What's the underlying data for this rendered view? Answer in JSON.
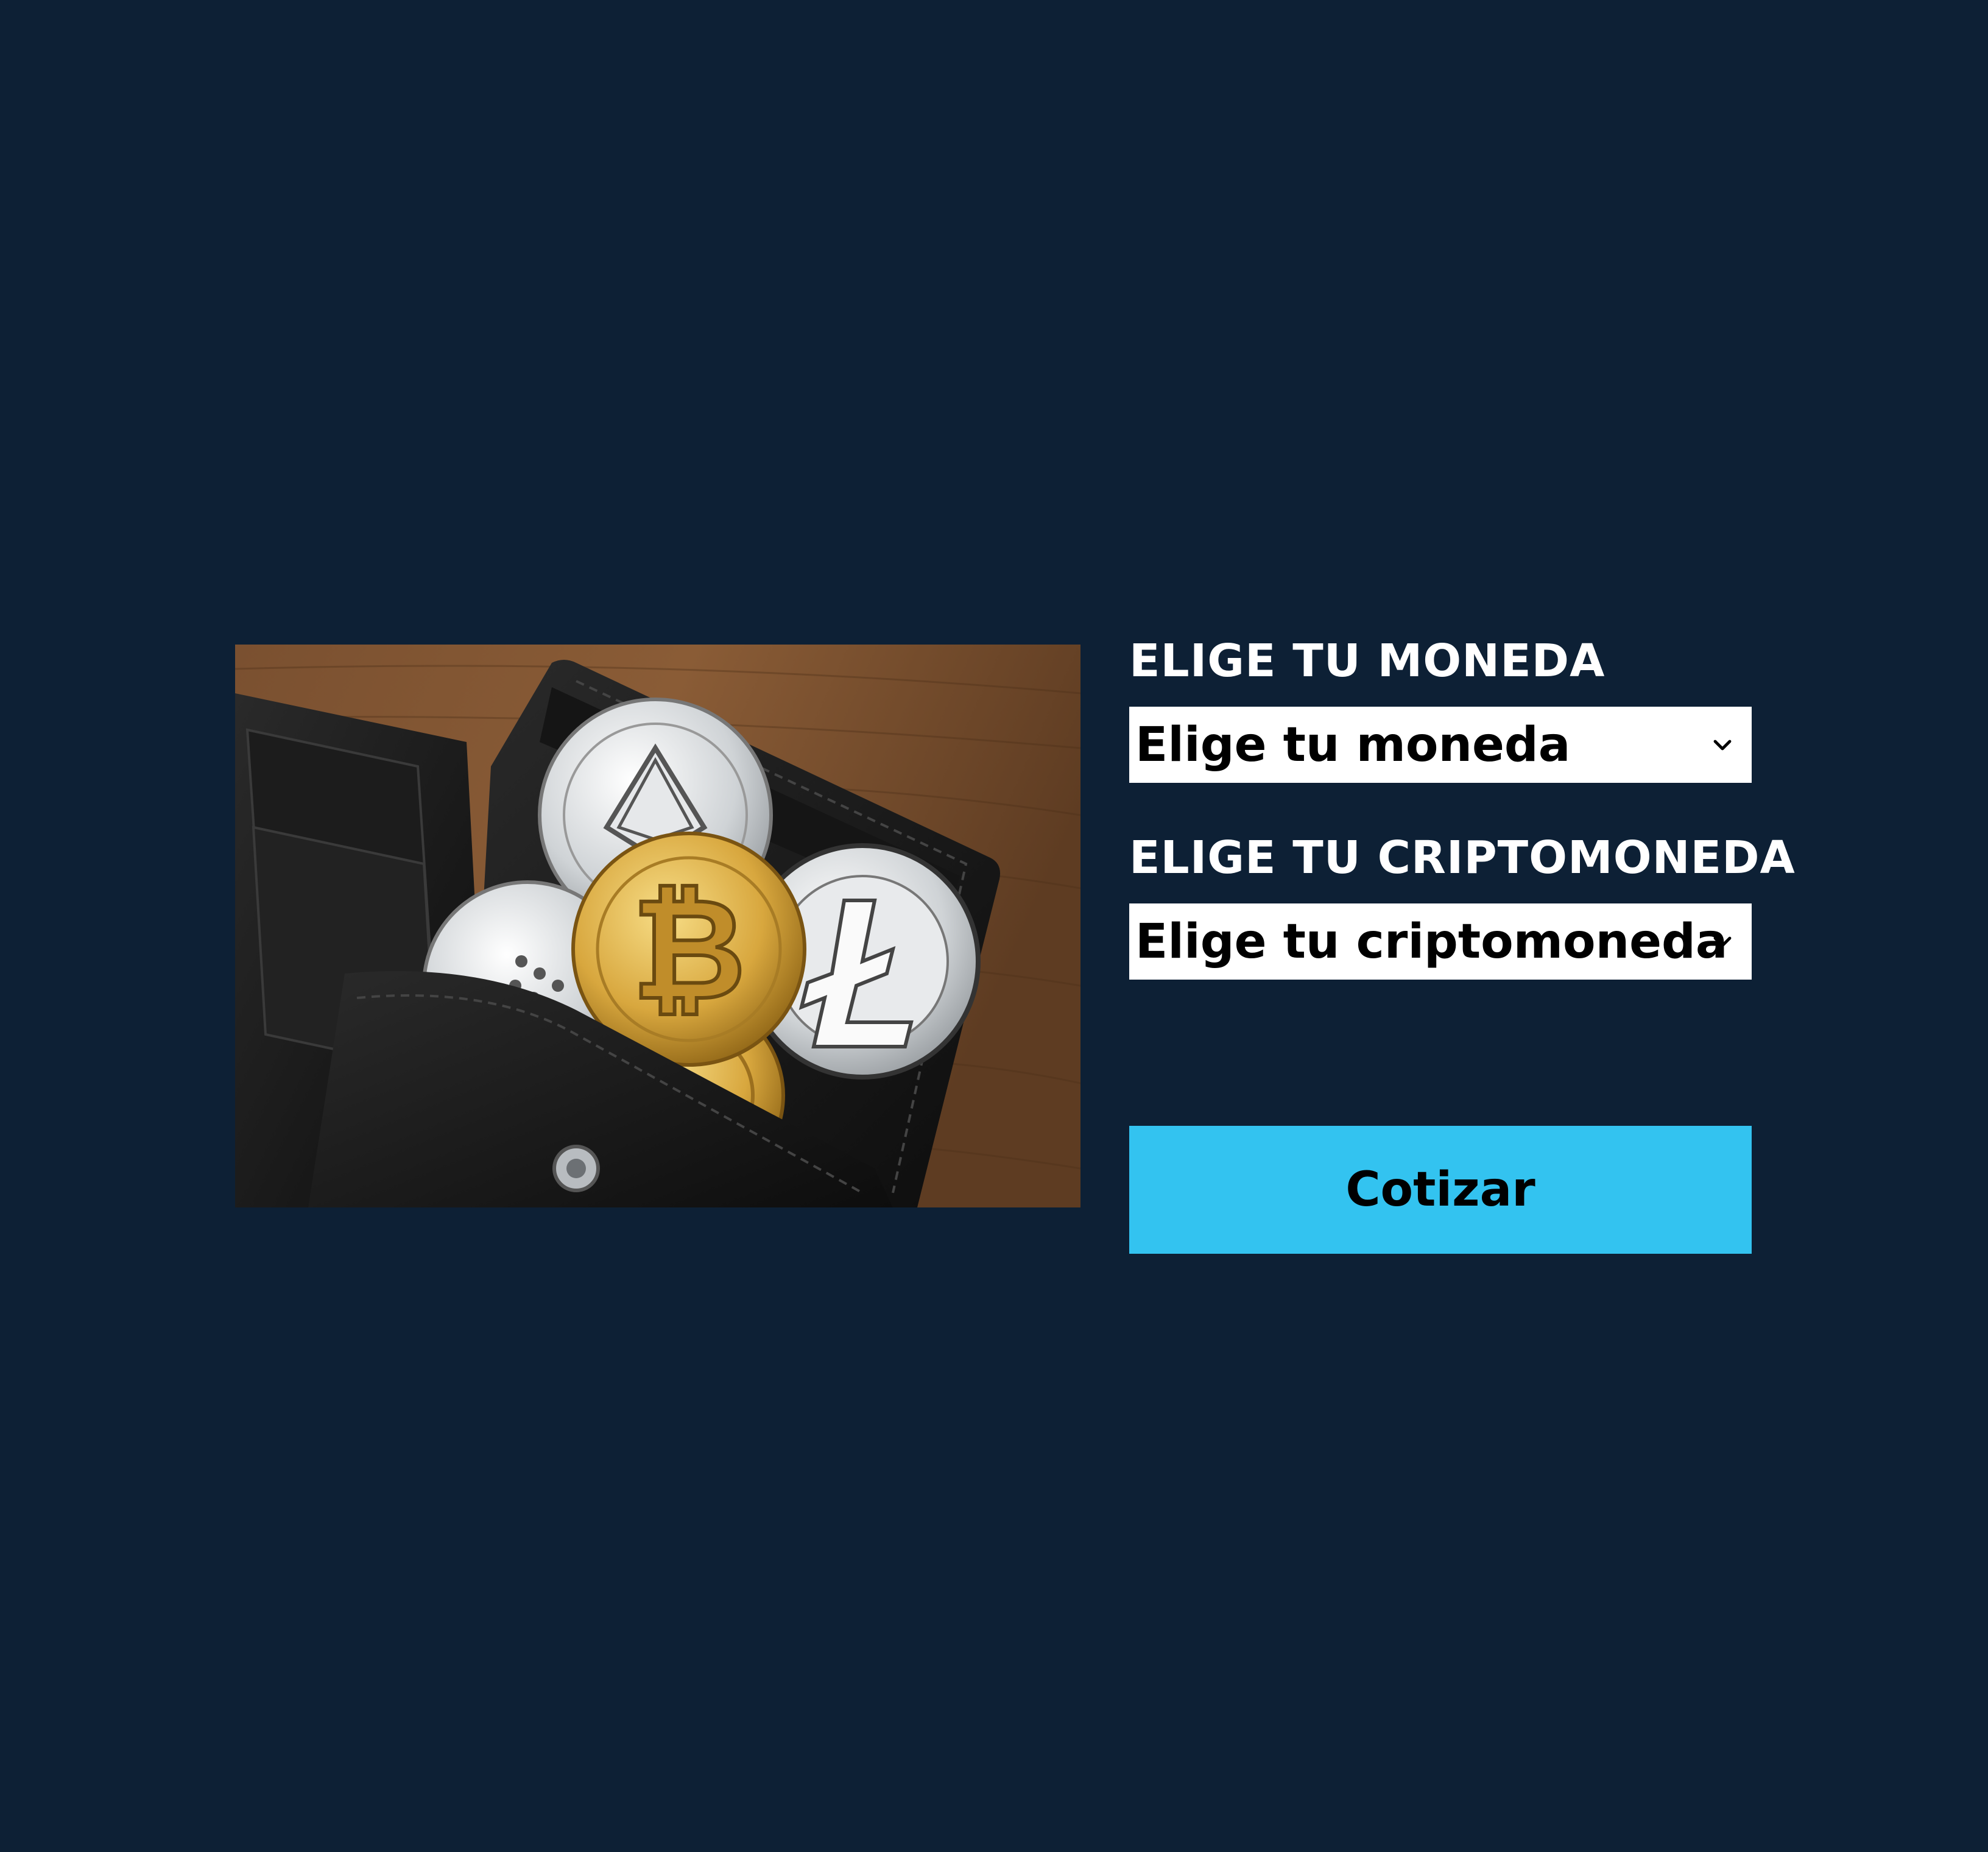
{
  "hero": {
    "image": "crypto-coins-in-wallet",
    "alt": "Monedas de criptomonedas en una billetera"
  },
  "form": {
    "currency_label": "ELIGE TU MONEDA",
    "currency_select": {
      "selected": "Elige tu moneda",
      "icon": "chevron-down-icon"
    },
    "crypto_label": "ELIGE TU CRIPTOMONEDA",
    "crypto_select": {
      "selected": "Elige tu criptomoneda",
      "icon": "chevron-down-icon"
    },
    "submit_label": "Cotizar"
  },
  "colors": {
    "background": "#0d2035",
    "button": "#33c3f0",
    "select_bg": "#ffffff",
    "label_text": "#ffffff"
  }
}
